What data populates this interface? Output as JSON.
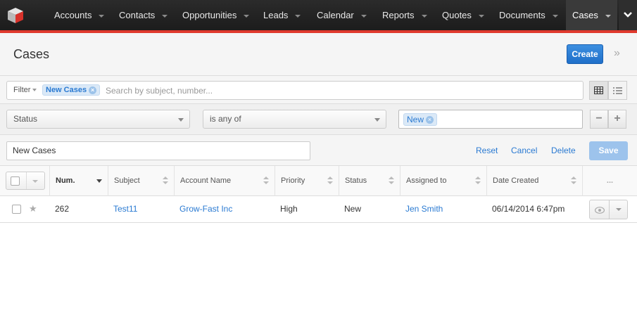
{
  "nav": {
    "items": [
      {
        "label": "Accounts"
      },
      {
        "label": "Contacts"
      },
      {
        "label": "Opportunities"
      },
      {
        "label": "Leads"
      },
      {
        "label": "Calendar"
      },
      {
        "label": "Reports"
      },
      {
        "label": "Quotes"
      },
      {
        "label": "Documents"
      },
      {
        "label": "Cases"
      }
    ],
    "active": "Cases",
    "more_icon": "chevron-down-icon"
  },
  "header": {
    "title": "Cases",
    "create_label": "Create",
    "expand_icon": "double-chevron-right-icon"
  },
  "filter": {
    "label": "Filter",
    "active_filter": "New Cases",
    "search_placeholder": "Search by subject, number...",
    "views": [
      "list-view-icon",
      "activity-stream-icon"
    ]
  },
  "filter_row": {
    "field": "Status",
    "operator": "is any of",
    "value": "New"
  },
  "save_row": {
    "name": "New Cases",
    "reset_label": "Reset",
    "cancel_label": "Cancel",
    "delete_label": "Delete",
    "save_label": "Save"
  },
  "table": {
    "columns": [
      "Num.",
      "Subject",
      "Account Name",
      "Priority",
      "Status",
      "Assigned to",
      "Date Created"
    ],
    "more_label": "...",
    "rows": [
      {
        "num": "262",
        "subject": "Test11",
        "account": "Grow-Fast Inc",
        "priority": "High",
        "status": "New",
        "assigned": "Jen Smith",
        "created": "06/14/2014 6:47pm"
      }
    ]
  },
  "colors": {
    "accent": "#2a7ad2",
    "brand_red": "#e03a2e",
    "nav_bg": "#222222"
  }
}
